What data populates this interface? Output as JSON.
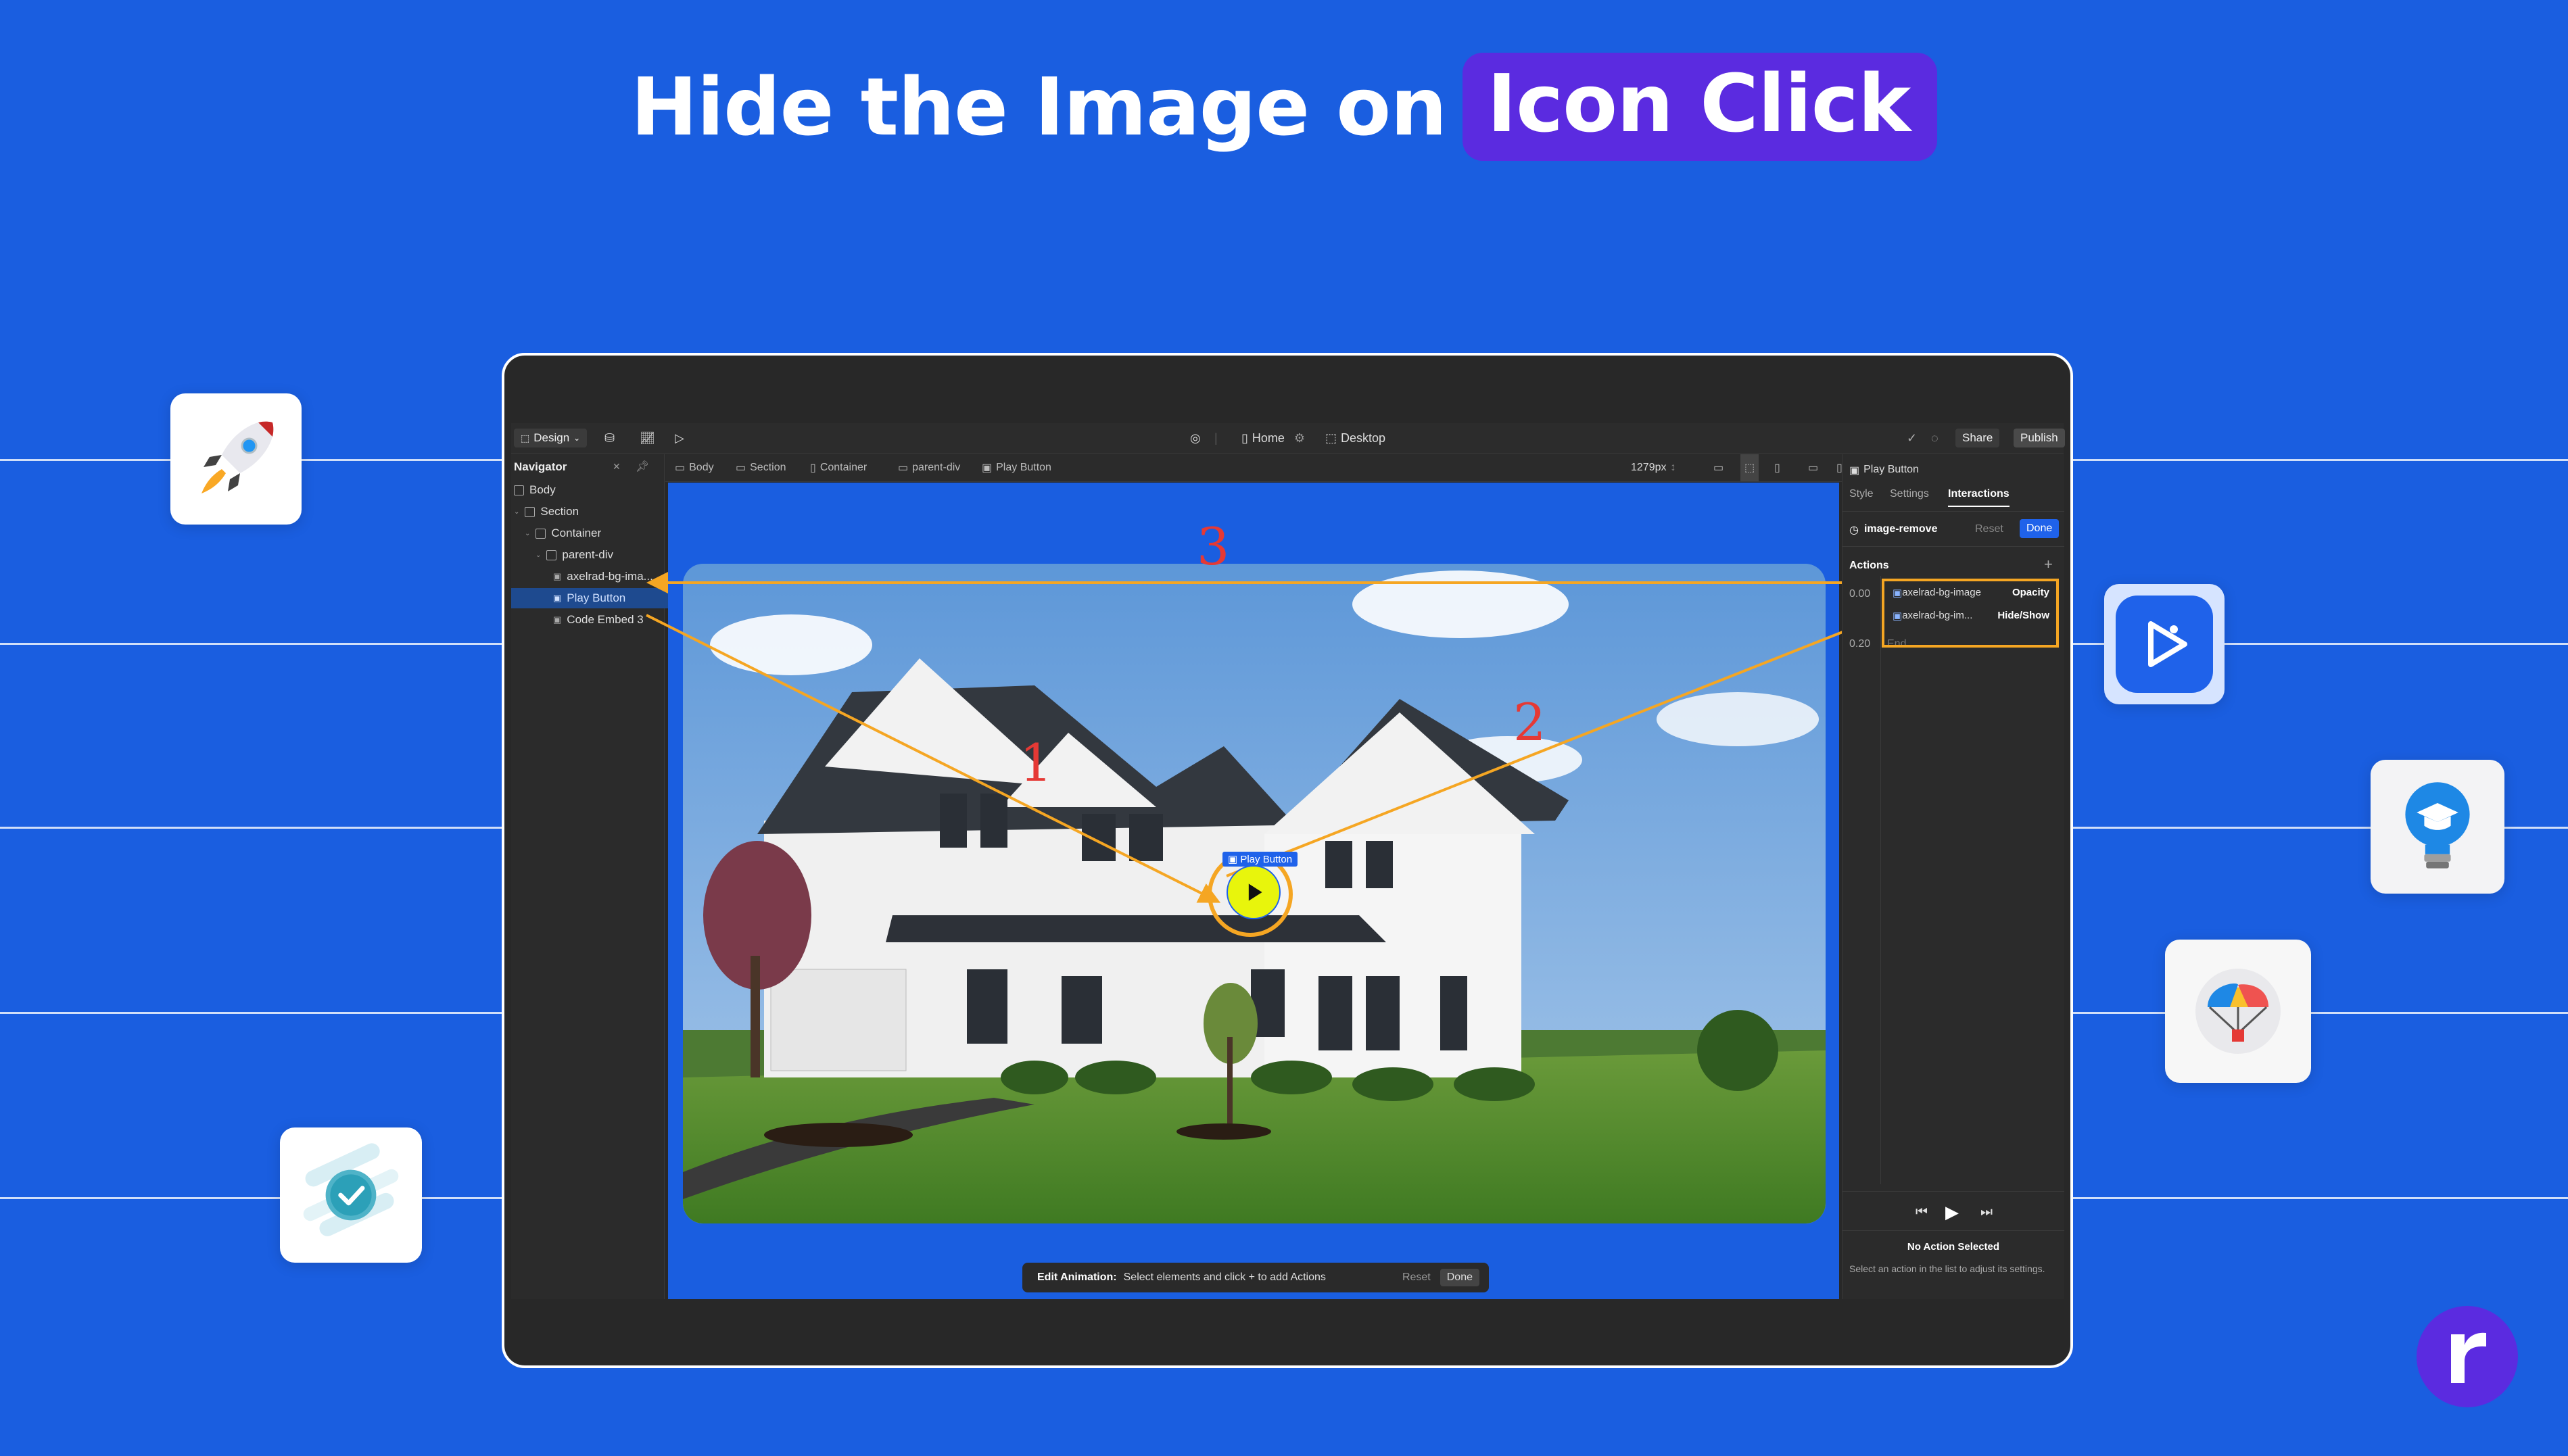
{
  "headline": {
    "part1": "Hide the Image on",
    "highlight": "Icon Click"
  },
  "topbar": {
    "design_label": "Design",
    "page_label": "Home",
    "breakpoint_label": "Desktop",
    "share_label": "Share",
    "publish_label": "Publish",
    "width_readout": "1279px"
  },
  "navigator": {
    "title": "Navigator",
    "items": [
      {
        "label": "Body"
      },
      {
        "label": "Section"
      },
      {
        "label": "Container"
      },
      {
        "label": "parent-div"
      },
      {
        "label": "axelrad-bg-ima..."
      },
      {
        "label": "Play Button"
      },
      {
        "label": "Code Embed 3"
      }
    ]
  },
  "breadcrumbs": [
    "Body",
    "Section",
    "Container",
    "parent-div",
    "Play Button"
  ],
  "canvas": {
    "play_badge": "Play Button",
    "annotations": [
      "1",
      "2",
      "3"
    ]
  },
  "edit_animation": {
    "label": "Edit Animation:",
    "hint": "Select elements and click + to add Actions",
    "reset": "Reset",
    "done": "Done"
  },
  "panel": {
    "element": "Play Button",
    "tabs": [
      "Style",
      "Settings",
      "Interactions"
    ],
    "interaction_name": "image-remove",
    "reset": "Reset",
    "done": "Done",
    "actions_title": "Actions",
    "times": [
      "0.00",
      "0.20"
    ],
    "end_label": "End",
    "actions": [
      {
        "target": "axelrad-bg-image",
        "type": "Opacity"
      },
      {
        "target": "axelrad-bg-im...",
        "type": "Hide/Show"
      }
    ],
    "no_action_title": "No Action Selected",
    "no_action_desc": "Select an action in the list to adjust its settings."
  },
  "colors": {
    "bg": "#1a5ee0",
    "accent": "#5b2be0",
    "highlight": "#f5a623"
  },
  "icons": [
    "rocket-icon",
    "play-app-icon",
    "lightbulb-grad-icon",
    "parachute-icon",
    "check-blob-icon",
    "brand-r-icon"
  ]
}
